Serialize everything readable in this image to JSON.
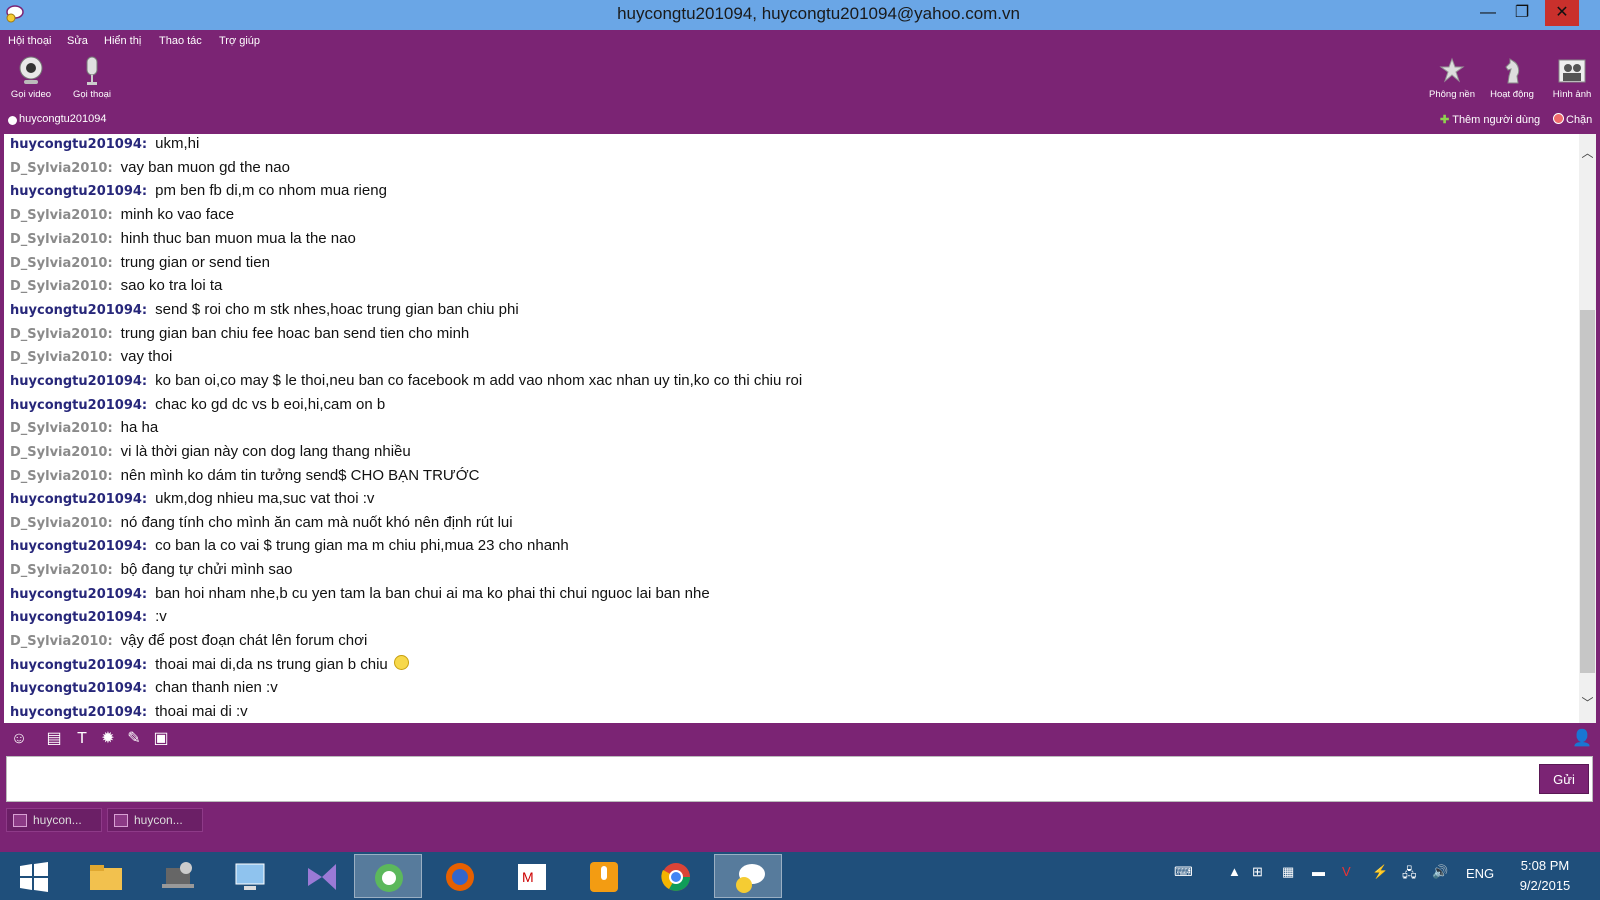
{
  "window": {
    "title": "huycongtu201094, huycongtu201094@yahoo.com.vn",
    "minimize_glyph": "—",
    "maximize_glyph": "❐",
    "close_glyph": "✕"
  },
  "menu": [
    "Hội thoại",
    "Sửa",
    "Hiển thị",
    "Thao tác",
    "Trợ giúp"
  ],
  "toolbar": {
    "video_call": "Gọi video",
    "voice_call": "Gọi thoại",
    "background": "Phông nền",
    "activity": "Hoạt động",
    "picture": "Hình ảnh"
  },
  "contact": {
    "name": "huycongtu201094",
    "add_user": "Thêm người dùng",
    "block": "Chặn"
  },
  "messages": [
    {
      "sender": "huycongtu201094:",
      "me": true,
      "text": "ukm,hi"
    },
    {
      "sender": "D_Sylvia2010:",
      "me": false,
      "text": "vay ban muon gd the nao"
    },
    {
      "sender": "huycongtu201094:",
      "me": true,
      "text": "pm ben fb di,m co nhom mua rieng"
    },
    {
      "sender": "D_Sylvia2010:",
      "me": false,
      "text": "minh ko vao face"
    },
    {
      "sender": "D_Sylvia2010:",
      "me": false,
      "text": "hinh thuc ban muon mua la the nao"
    },
    {
      "sender": "D_Sylvia2010:",
      "me": false,
      "text": "trung gian or send tien"
    },
    {
      "sender": "D_Sylvia2010:",
      "me": false,
      "text": "sao ko tra loi ta"
    },
    {
      "sender": "huycongtu201094:",
      "me": true,
      "text": "send $ roi cho m stk nhes,hoac trung gian ban chiu phi"
    },
    {
      "sender": "D_Sylvia2010:",
      "me": false,
      "text": "trung gian ban chiu fee hoac ban send tien cho minh"
    },
    {
      "sender": "D_Sylvia2010:",
      "me": false,
      "text": "vay thoi"
    },
    {
      "sender": "huycongtu201094:",
      "me": true,
      "text": "ko ban oi,co may $ le thoi,neu ban co facebook m add vao nhom  xac nhan uy tin,ko co thi chiu roi"
    },
    {
      "sender": "huycongtu201094:",
      "me": true,
      "text": "chac ko gd dc vs b eoi,hi,cam on b"
    },
    {
      "sender": "D_Sylvia2010:",
      "me": false,
      "text": "ha ha"
    },
    {
      "sender": "D_Sylvia2010:",
      "me": false,
      "text": "vi là thời gian này con dog lang thang nhiều"
    },
    {
      "sender": "D_Sylvia2010:",
      "me": false,
      "text": "nên mình ko dám tin tưởng send$ CHO BẠN TRƯỚC"
    },
    {
      "sender": "huycongtu201094:",
      "me": true,
      "text": "ukm,dog nhieu ma,suc vat thoi :v"
    },
    {
      "sender": "D_Sylvia2010:",
      "me": false,
      "text": "nó đang tính cho mình ăn cam mà nuốt khó nên định rút lui"
    },
    {
      "sender": "huycongtu201094:",
      "me": true,
      "text": "co ban la co vai $ trung gian ma m chiu phi,mua 23 cho nhanh"
    },
    {
      "sender": "D_Sylvia2010:",
      "me": false,
      "text": "bộ đang tự chửi mình sao"
    },
    {
      "sender": "huycongtu201094:",
      "me": true,
      "text": "ban hoi nham nhe,b cu yen tam la ban chui ai ma ko phai thi chui nguoc lai ban nhe"
    },
    {
      "sender": "huycongtu201094:",
      "me": true,
      "text": ":v"
    },
    {
      "sender": "D_Sylvia2010:",
      "me": false,
      "text": "vậy để post đoạn chát lên forum chơi"
    },
    {
      "sender": "huycongtu201094:",
      "me": true,
      "text": "thoai mai di,da ns trung gian b chiu",
      "smiley": true
    },
    {
      "sender": "huycongtu201094:",
      "me": true,
      "text": "chan thanh nien :v"
    },
    {
      "sender": "huycongtu201094:",
      "me": true,
      "text": "thoai mai di :v"
    }
  ],
  "input": {
    "value": "",
    "send_label": "Gửi"
  },
  "conversation_tabs": [
    "huycon...",
    "huycon..."
  ],
  "taskbar": {
    "language": "ENG",
    "time": "5:08 PM",
    "date": "9/2/2015"
  }
}
